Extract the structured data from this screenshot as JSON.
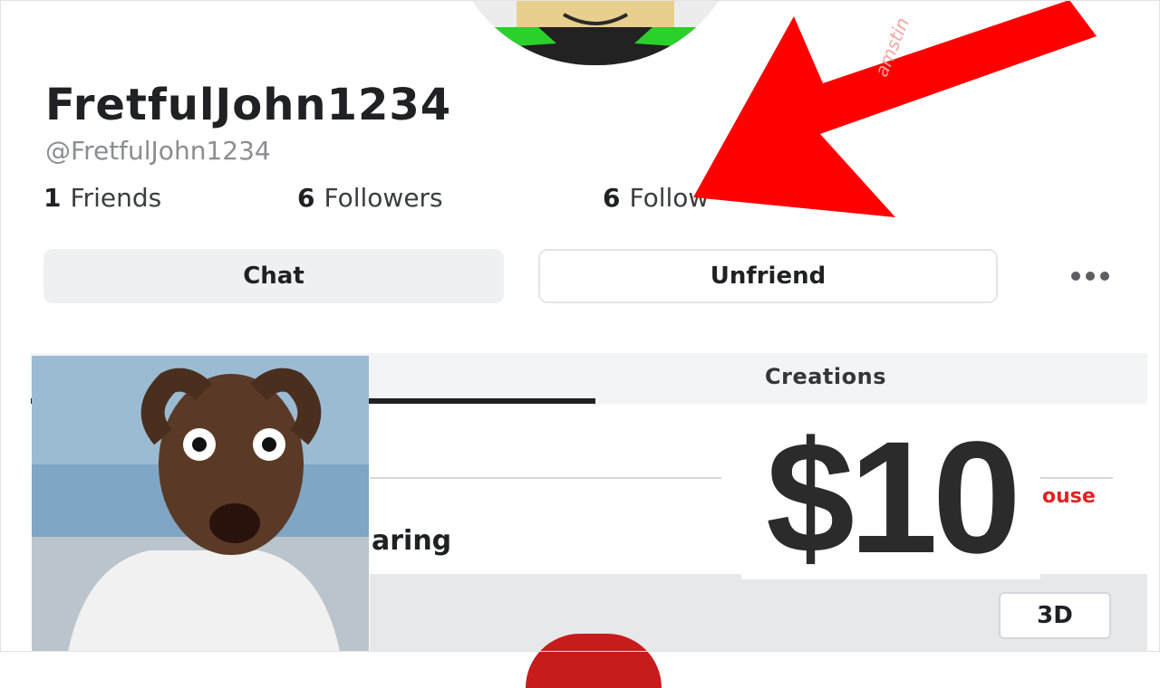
{
  "profile": {
    "display_name": "FretfulJohn1234",
    "username": "@FretfulJohn1234",
    "stats": [
      {
        "count": "1",
        "label": "Friends"
      },
      {
        "count": "6",
        "label": "Followers"
      },
      {
        "count": "6",
        "label": "Follow"
      }
    ]
  },
  "actions": {
    "chat_label": "Chat",
    "unfriend_label": "Unfriend",
    "more_icon": "more-options-icon"
  },
  "tabs": {
    "creations_label": "Creations"
  },
  "section": {
    "title_partial": "aring",
    "link_partial": "ouse"
  },
  "viewer": {
    "toggle_3d": "3D"
  },
  "overlay": {
    "price": "$10",
    "arrow_color": "#ff0000",
    "watermark": "amstin"
  },
  "colors": {
    "accent_red": "#e02424",
    "arrow_red": "#ff0000"
  }
}
